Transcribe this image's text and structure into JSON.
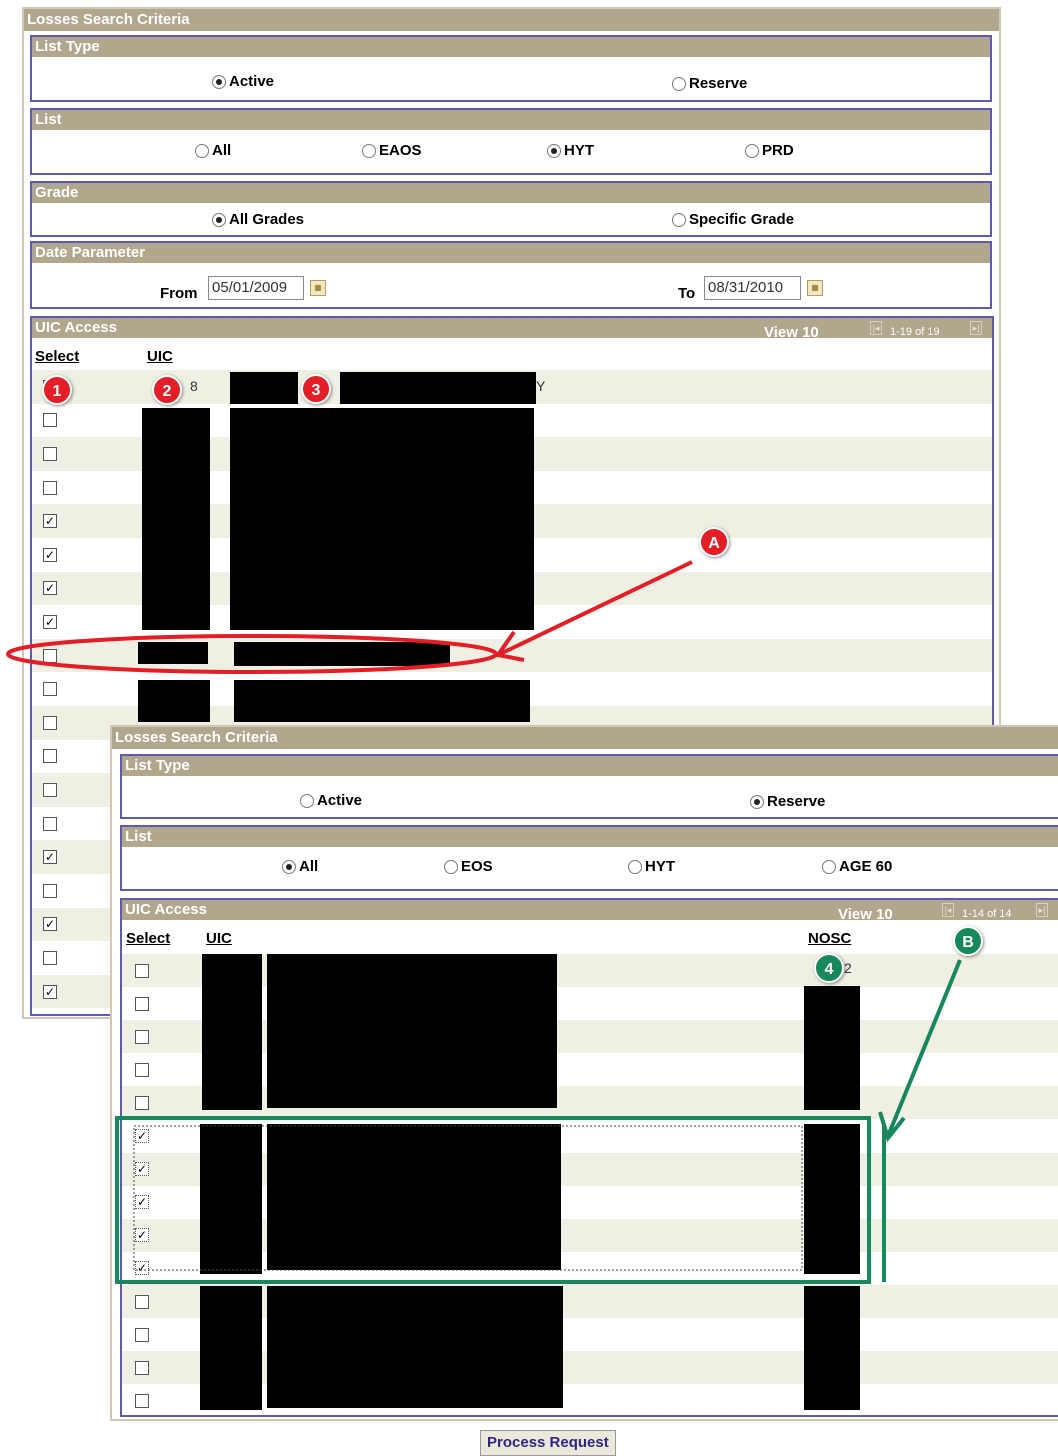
{
  "back_panel": {
    "title": "Losses Search Criteria",
    "list_type": {
      "title": "List Type",
      "options": [
        {
          "label": "Active",
          "selected": true
        },
        {
          "label": "Reserve",
          "selected": false
        }
      ]
    },
    "list": {
      "title": "List",
      "options": [
        {
          "label": "All",
          "selected": false
        },
        {
          "label": "EAOS",
          "selected": false
        },
        {
          "label": "HYT",
          "selected": true
        },
        {
          "label": "PRD",
          "selected": false
        }
      ]
    },
    "grade": {
      "title": "Grade",
      "options": [
        {
          "label": "All Grades",
          "selected": true
        },
        {
          "label": "Specific Grade",
          "selected": false
        }
      ]
    },
    "date_parameter": {
      "title": "Date Parameter",
      "from_label": "From",
      "from_value": "05/01/2009",
      "to_label": "To",
      "to_value": "08/31/2010"
    },
    "uic_access": {
      "title": "UIC Access",
      "view_link": "View 10",
      "pager": "1-19 of 19",
      "col_select": "Select",
      "col_uic": "UIC",
      "row_uic_fragment": "8",
      "row_name_fragment": "Y",
      "rows_checked": [
        false,
        false,
        false,
        false,
        true,
        true,
        true,
        true,
        false,
        false,
        false,
        false,
        false,
        false,
        true,
        false,
        true,
        false,
        true
      ]
    }
  },
  "front_panel": {
    "title": "Losses Search Criteria",
    "list_type": {
      "title": "List Type",
      "options": [
        {
          "label": "Active",
          "selected": false
        },
        {
          "label": "Reserve",
          "selected": true
        }
      ]
    },
    "list": {
      "title": "List",
      "options": [
        {
          "label": "All",
          "selected": true
        },
        {
          "label": "EOS",
          "selected": false
        },
        {
          "label": "HYT",
          "selected": false
        },
        {
          "label": "AGE 60",
          "selected": false
        }
      ]
    },
    "uic_access": {
      "title": "UIC Access",
      "view_link": "View 10",
      "pager": "1-14 of 14",
      "col_select": "Select",
      "col_uic": "UIC",
      "col_nosc": "NOSC",
      "nosc_fragment": "2",
      "rows_checked": [
        false,
        false,
        false,
        false,
        false,
        true,
        true,
        true,
        true,
        true,
        false,
        false,
        false,
        false
      ]
    },
    "process_button": "Process Request"
  },
  "annotations": {
    "badges": [
      "1",
      "2",
      "3",
      "A",
      "4",
      "B"
    ],
    "colors": {
      "red": "#e41e26",
      "green": "#17885a",
      "section_border": "#5d5ab5",
      "title_bar": "#b0a78c"
    }
  },
  "icons": {
    "calendar": "calendar-icon",
    "pager_first": "first-page-icon",
    "pager_last": "last-page-icon"
  }
}
